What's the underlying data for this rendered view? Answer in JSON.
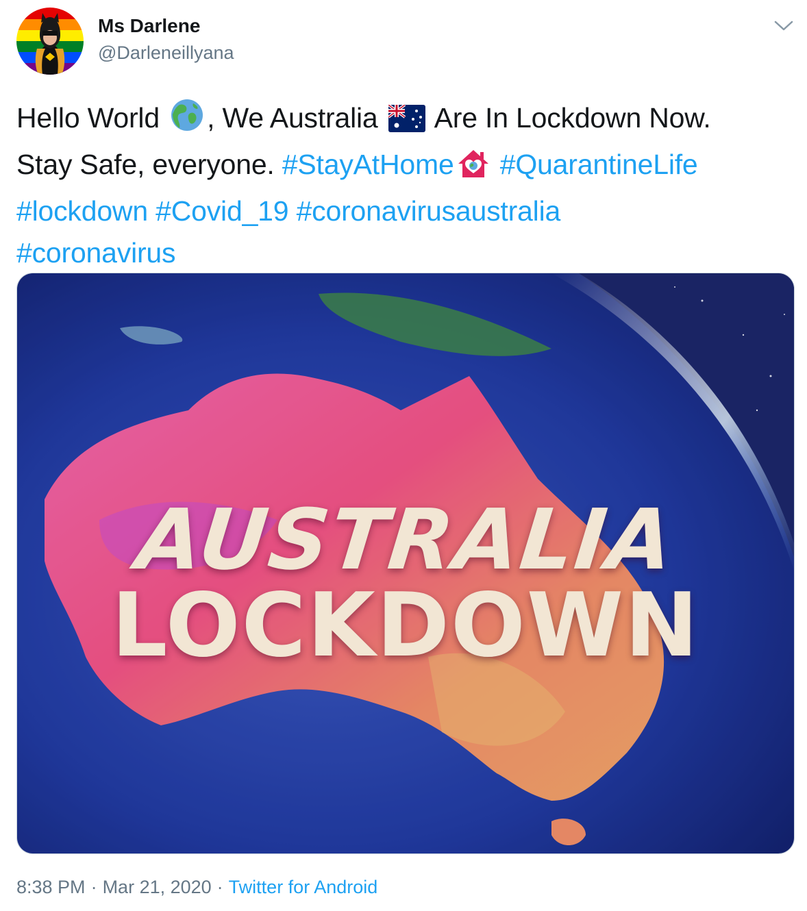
{
  "author": {
    "name": "Ms Darlene",
    "handle": "@Darleneillyana"
  },
  "tweet": {
    "line1": {
      "t1": "Hello World ",
      "t2": ", We Australia ",
      "t3": " Are In Lockdown Now."
    },
    "line2": {
      "t1": "Stay Safe, everyone. ",
      "tag1": "#StayAtHome",
      "tag2": "#QuarantineLife"
    },
    "line3": {
      "tag1": "#lockdown",
      "tag2": "#Covid_19",
      "tag3": "#coronavirusaustralia"
    },
    "line4": {
      "tag1": "#coronavirus"
    }
  },
  "media": {
    "line1": "AUSTRALIA",
    "line2": "LOCKDOWN"
  },
  "meta": {
    "time": "8:38 PM",
    "dot": "·",
    "date": "Mar 21, 2020",
    "source": "Twitter for Android"
  },
  "icons": {
    "avatar": "rainbow-avatar-icon",
    "caret": "chevron-down-icon",
    "globe": "globe-emoji-icon",
    "flag": "australia-flag-emoji-icon",
    "house": "house-with-heart-emoji-icon"
  },
  "colors": {
    "link": "#1da1f2",
    "text": "#14171a",
    "secondary": "#657786"
  }
}
